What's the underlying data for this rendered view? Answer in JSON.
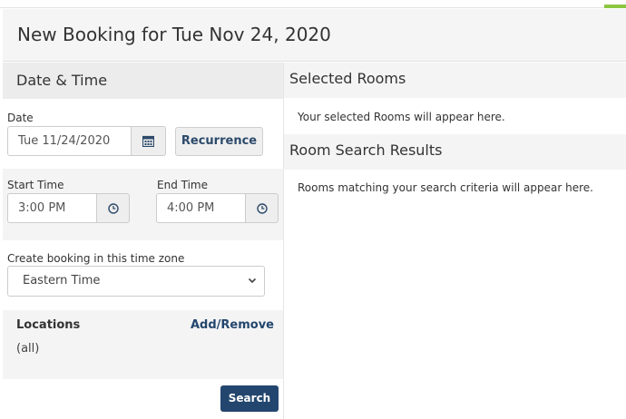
{
  "header": {
    "title": "New Booking for Tue Nov 24, 2020"
  },
  "left": {
    "section_title": "Date & Time",
    "date": {
      "label": "Date",
      "value": "Tue 11/24/2020",
      "calendar_icon": "calendar-icon"
    },
    "recurrence_label": "Recurrence",
    "start": {
      "label": "Start Time",
      "value": "3:00 PM",
      "icon": "clock-icon"
    },
    "end": {
      "label": "End Time",
      "value": "4:00 PM",
      "icon": "clock-icon"
    },
    "timezone": {
      "label": "Create booking in this time zone",
      "selected": "Eastern Time"
    },
    "locations": {
      "title": "Locations",
      "action": "Add/Remove",
      "value": "(all)"
    },
    "search_label": "Search"
  },
  "right": {
    "selected_rooms": {
      "title": "Selected Rooms",
      "placeholder": "Your selected Rooms will appear here."
    },
    "results": {
      "title": "Room Search Results",
      "placeholder": "Rooms matching your search criteria will appear here."
    }
  },
  "colors": {
    "primary": "#23466e",
    "accent": "#8cc63f"
  }
}
